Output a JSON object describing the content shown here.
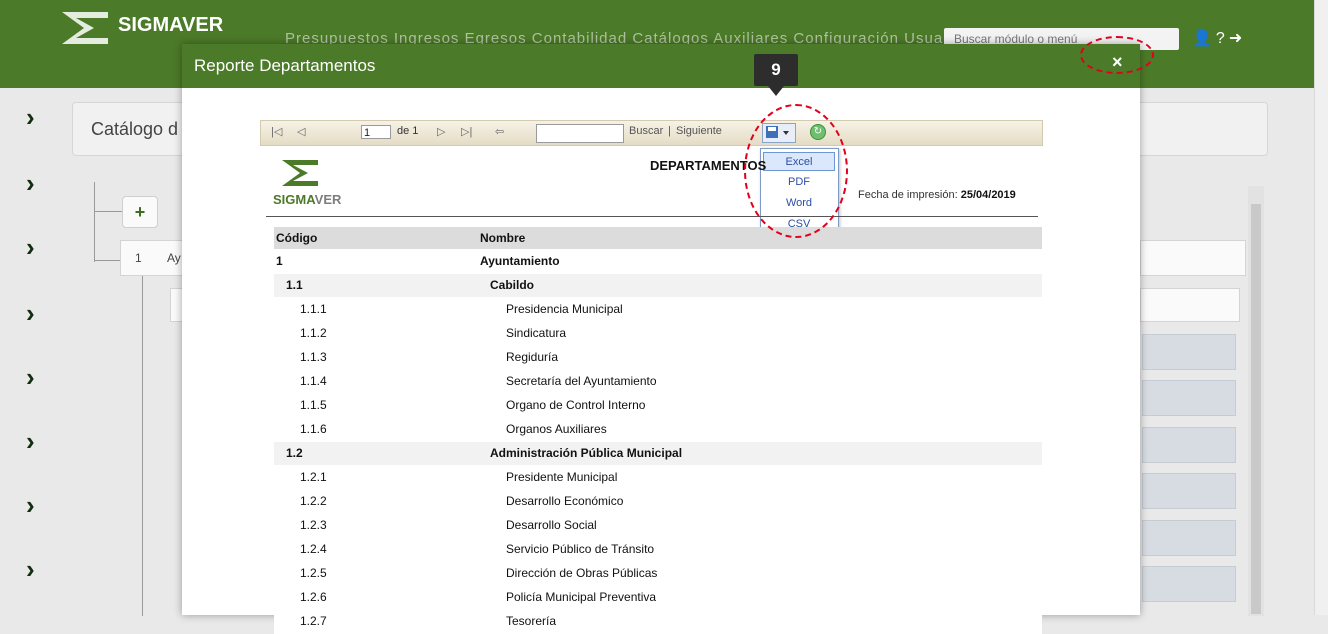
{
  "app": {
    "logo_text": "SIGMAVER",
    "menu_text": "Presupuestos  Ingresos  Egresos  Contabilidad  Catálogos  Auxiliares  Configuración  Usuarios",
    "search_placeholder": "Buscar módulo o menú",
    "catalog_title": "Catálogo d",
    "tree_row_code": "1",
    "tree_row_label": "Ay"
  },
  "modal": {
    "title": "Reporte Departamentos",
    "close_label": "×"
  },
  "toolbar": {
    "first": "|◁",
    "prev": "◁",
    "page_value": "1",
    "of_label": "de 1",
    "next": "▷",
    "last": "▷|",
    "back": "⇦",
    "find_label": "Buscar",
    "separator": "|",
    "next_label": "Siguiente"
  },
  "export_menu": {
    "items": [
      "Excel",
      "PDF",
      "Word",
      "CSV"
    ],
    "selected": "Excel"
  },
  "annotation": {
    "badge": "9",
    "ring_color": "#e3001b"
  },
  "report": {
    "logo_text_a": "SIGMA",
    "logo_text_b": "VER",
    "title": "DEPARTAMENTOS",
    "print_date_label": "Fecha de impresión:",
    "print_date": "25/04/2019",
    "columns": [
      "Código",
      "Nombre"
    ],
    "rows": [
      {
        "code": "1",
        "name": "Ayuntamiento",
        "level": 1
      },
      {
        "code": "1.1",
        "name": "Cabildo",
        "level": 2
      },
      {
        "code": "1.1.1",
        "name": "Presidencia Municipal",
        "level": 3
      },
      {
        "code": "1.1.2",
        "name": "Sindicatura",
        "level": 3
      },
      {
        "code": "1.1.3",
        "name": "Regiduría",
        "level": 3
      },
      {
        "code": "1.1.4",
        "name": "Secretaría del Ayuntamiento",
        "level": 3
      },
      {
        "code": "1.1.5",
        "name": "Organo de Control Interno",
        "level": 3
      },
      {
        "code": "1.1.6",
        "name": "Organos Auxiliares",
        "level": 3
      },
      {
        "code": "1.2",
        "name": "Administración Pública Municipal",
        "level": 2
      },
      {
        "code": "1.2.1",
        "name": "Presidente Municipal",
        "level": 3
      },
      {
        "code": "1.2.2",
        "name": "Desarrollo Económico",
        "level": 3
      },
      {
        "code": "1.2.3",
        "name": "Desarrollo Social",
        "level": 3
      },
      {
        "code": "1.2.4",
        "name": "Servicio Público de Tránsito",
        "level": 3
      },
      {
        "code": "1.2.5",
        "name": "Dirección de Obras Públicas",
        "level": 3
      },
      {
        "code": "1.2.6",
        "name": "Policía Municipal Preventiva",
        "level": 3
      },
      {
        "code": "1.2.7",
        "name": "Tesorería",
        "level": 3
      }
    ]
  },
  "colors": {
    "header_green": "#4b7a28",
    "link_blue": "#2a4ea6"
  }
}
